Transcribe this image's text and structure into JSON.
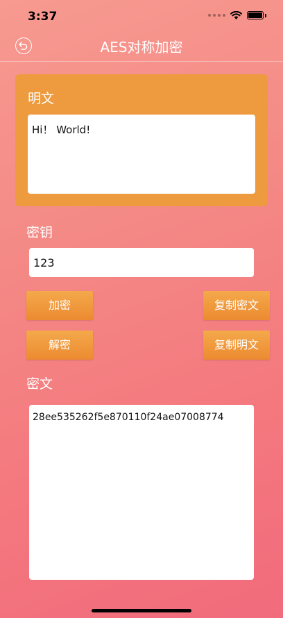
{
  "status": {
    "time": "3:37"
  },
  "nav": {
    "title": "AES对称加密"
  },
  "plaintext": {
    "label": "明文",
    "value": "Hi！ World!"
  },
  "key": {
    "label": "密钥",
    "value": "123"
  },
  "buttons": {
    "encrypt": "加密",
    "decrypt": "解密",
    "copy_cipher": "复制密文",
    "copy_plain": "复制明文"
  },
  "ciphertext": {
    "label": "密文",
    "value": "28ee535262f5e870110f24ae07008774"
  },
  "colors": {
    "card": "#ee9a3e",
    "button": "#ec8a31",
    "background": "#f4787e"
  },
  "icons": {
    "back": "back-arrow-icon",
    "wifi": "wifi-icon",
    "battery": "battery-icon",
    "signal": "signal-icon"
  }
}
